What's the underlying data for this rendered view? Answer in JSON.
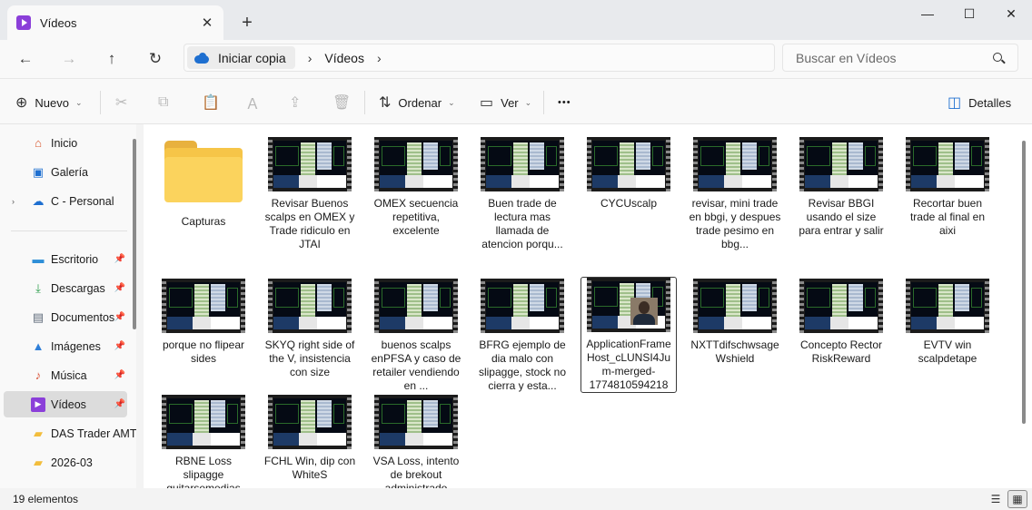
{
  "window": {
    "tab_title": "Vídeos",
    "tab_close": "✕",
    "new_tab": "+",
    "controls": {
      "minimize": "—",
      "maximize": "☐",
      "close": "✕"
    }
  },
  "address": {
    "back": "←",
    "forward": "→",
    "up": "↑",
    "refresh": "↻",
    "breadcrumbs": [
      "Iniciar copia",
      "Vídeos"
    ],
    "separator": "›",
    "search_placeholder": "Buscar en Vídeos"
  },
  "commands": {
    "new_label": "Nuevo",
    "sort_label": "Ordenar",
    "view_label": "Ver",
    "more": "•••",
    "details_label": "Detalles",
    "chevron": "⌄",
    "icons": {
      "new": "⊕",
      "cut": "✂",
      "copy": "⧉",
      "paste": "📋",
      "rename": "Ａ",
      "share": "⇪",
      "delete": "🗑",
      "sort": "⇅",
      "view": "▭",
      "details": "◫"
    }
  },
  "sidebar": {
    "top": [
      {
        "label": "Inicio",
        "icon": "home-icon",
        "glyph": "⌂",
        "color": "#d9552b"
      },
      {
        "label": "Galería",
        "icon": "gallery-icon",
        "glyph": "▣",
        "color": "#1e6fd0"
      },
      {
        "label": "C - Personal",
        "icon": "onedrive-icon",
        "glyph": "☁",
        "color": "#1e6fd0",
        "expand": "›"
      }
    ],
    "quick": [
      {
        "label": "Escritorio",
        "icon": "desktop-icon",
        "glyph": "▬",
        "color": "#2f8fd8",
        "pinned": true
      },
      {
        "label": "Descargas",
        "icon": "downloads-icon",
        "glyph": "⤓",
        "color": "#2a9d4a",
        "pinned": true
      },
      {
        "label": "Documentos",
        "icon": "documents-icon",
        "glyph": "▤",
        "color": "#5f6b7a",
        "pinned": true
      },
      {
        "label": "Imágenes",
        "icon": "pictures-icon",
        "glyph": "▲",
        "color": "#2f7fd8",
        "pinned": true
      },
      {
        "label": "Música",
        "icon": "music-icon",
        "glyph": "♪",
        "color": "#d9553a",
        "pinned": true
      },
      {
        "label": "Vídeos",
        "icon": "videos-icon",
        "glyph": "▶",
        "color": "#8b3fd9",
        "pinned": true,
        "active": true
      },
      {
        "label": "DAS Trader AMT",
        "icon": "folder-icon",
        "glyph": "▰",
        "color": "#f2bd3c",
        "pinned": false
      },
      {
        "label": "2026-03",
        "icon": "folder-icon",
        "glyph": "▰",
        "color": "#f2bd3c",
        "pinned": false
      }
    ],
    "pin_glyph": "📌"
  },
  "files": [
    {
      "name": "Capturas",
      "kind": "folder"
    },
    {
      "name": "Revisar Buenos scalps en OMEX y Trade ridiculo en JTAI",
      "kind": "video"
    },
    {
      "name": "OMEX secuencia repetitiva, excelente",
      "kind": "video"
    },
    {
      "name": "Buen trade de lectura mas llamada de atencion porqu...",
      "kind": "video"
    },
    {
      "name": "CYCUscalp",
      "kind": "video"
    },
    {
      "name": "revisar, mini trade en bbgi, y despues trade pesimo en bbg...",
      "kind": "video"
    },
    {
      "name": "Revisar BBGI usando el size para entrar y salir",
      "kind": "video"
    },
    {
      "name": "Recortar buen trade al final en aixi",
      "kind": "video"
    },
    {
      "name": "porque no flipear sides",
      "kind": "video"
    },
    {
      "name": "SKYQ right side of the V, insistencia con size",
      "kind": "video"
    },
    {
      "name": "buenos scalps enPFSA y caso de retailer vendiendo en ...",
      "kind": "video"
    },
    {
      "name": "BFRG ejemplo de dia malo con slipagge, stock no cierra y esta...",
      "kind": "video"
    },
    {
      "name": "ApplicationFrameHost_cLUNSI4Jum-merged-1774810594218",
      "kind": "video",
      "selected": true,
      "webcam": true
    },
    {
      "name": "NXTTdifschwsageWshield",
      "kind": "video"
    },
    {
      "name": "Concepto Rector RiskReward",
      "kind": "video"
    },
    {
      "name": "EVTV win scalpdetape",
      "kind": "video"
    },
    {
      "name": "RBNE Loss slipagge guitarsemedias",
      "kind": "video"
    },
    {
      "name": "FCHL Win, dip con WhiteS",
      "kind": "video"
    },
    {
      "name": "VSA Loss, intento de brekout administrado",
      "kind": "video"
    }
  ],
  "status": {
    "count": "19 elementos",
    "view_details": "☰",
    "view_icons": "▦"
  }
}
